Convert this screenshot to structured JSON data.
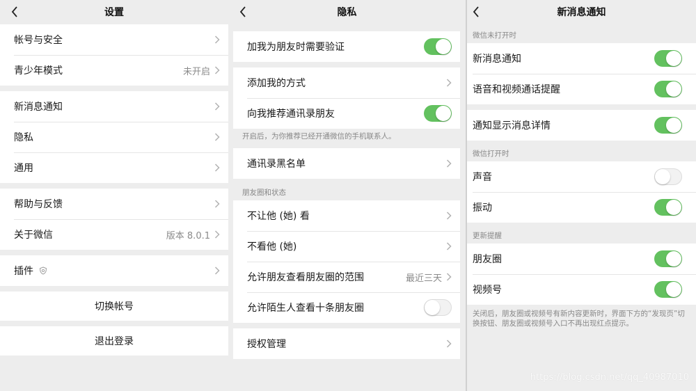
{
  "settings": {
    "title": "设置",
    "groups": [
      [
        {
          "label": "帐号与安全"
        },
        {
          "label": "青少年模式",
          "value": "未开启"
        }
      ],
      [
        {
          "label": "新消息通知"
        },
        {
          "label": "隐私"
        },
        {
          "label": "通用"
        }
      ],
      [
        {
          "label": "帮助与反馈"
        },
        {
          "label": "关于微信",
          "value": "版本 8.0.1"
        }
      ],
      [
        {
          "label": "插件"
        }
      ]
    ],
    "switch_account": "切换帐号",
    "logout": "退出登录"
  },
  "privacy": {
    "title": "隐私",
    "verify_friend": "加我为朋友时需要验证",
    "add_methods": "添加我的方式",
    "recommend_contacts": "向我推荐通讯录朋友",
    "recommend_note": "开启后，为你推荐已经开通微信的手机联系人。",
    "blacklist": "通讯录黑名单",
    "moments_section": "朋友圈和状态",
    "dont_let_see": "不让他 (她) 看",
    "dont_see": "不看他 (她)",
    "moments_range": "允许朋友查看朋友圈的范围",
    "moments_range_value": "最近三天",
    "strangers_ten": "允许陌生人查看十条朋友圈",
    "auth_manage": "授权管理",
    "toggles": {
      "verify_friend": true,
      "recommend_contacts": true,
      "strangers_ten": false
    }
  },
  "notify": {
    "title": "新消息通知",
    "section_closed": "微信未打开时",
    "new_msg": "新消息通知",
    "voice_video": "语音和视频通话提醒",
    "show_detail": "通知显示消息详情",
    "section_open": "微信打开时",
    "sound": "声音",
    "vibrate": "振动",
    "section_update": "更新提醒",
    "moments": "朋友圈",
    "channels": "视频号",
    "update_note": "关闭后，朋友圈或视频号有新内容更新时，界面下方的“发现页”切换按钮、朋友圈或视频号入口不再出现红点提示。",
    "toggles": {
      "new_msg": true,
      "voice_video": true,
      "show_detail": true,
      "sound": false,
      "vibrate": true,
      "moments": true,
      "channels": true
    }
  },
  "watermark": "https://blog.csdn.net/qq_40987010",
  "colors": {
    "toggle_on": "#63c15f",
    "background": "#ededed"
  }
}
